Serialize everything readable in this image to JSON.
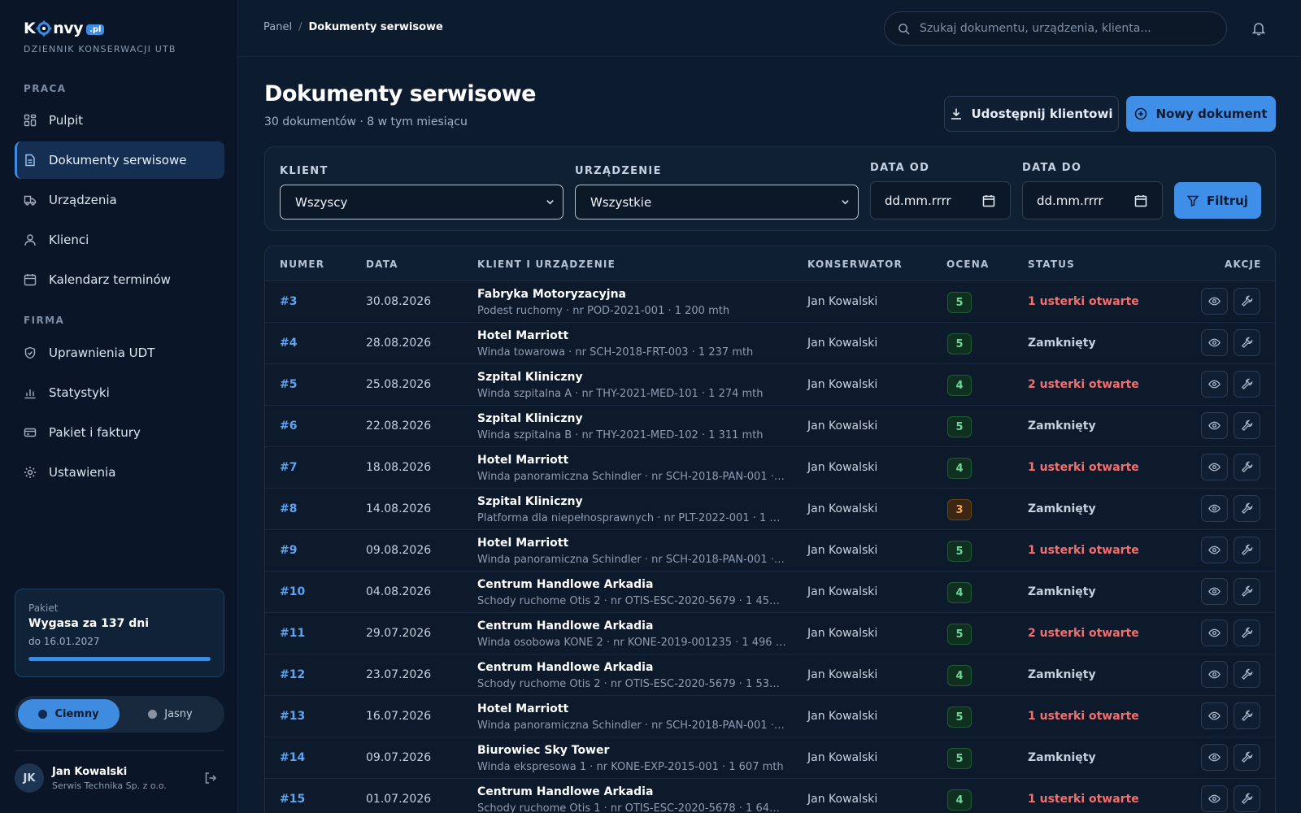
{
  "brand": {
    "logo_left": "K",
    "logo_right": "nvy",
    "logo_badge": ".pl",
    "subtitle": "DZIENNIK KONSERWACJI UTB"
  },
  "sidebar": {
    "section_work": "PRACA",
    "section_company": "FIRMA",
    "items": [
      {
        "label": "Pulpit",
        "icon": "dashboard-icon"
      },
      {
        "label": "Dokumenty serwisowe",
        "icon": "document-icon",
        "active": true
      },
      {
        "label": "Urządzenia",
        "icon": "device-icon"
      },
      {
        "label": "Klienci",
        "icon": "user-icon"
      },
      {
        "label": "Kalendarz terminów",
        "icon": "calendar-icon"
      },
      {
        "label": "Uprawnienia UDT",
        "icon": "shield-icon"
      },
      {
        "label": "Statystyki",
        "icon": "chart-icon"
      },
      {
        "label": "Pakiet i faktury",
        "icon": "card-icon"
      },
      {
        "label": "Ustawienia",
        "icon": "gear-icon"
      }
    ],
    "package": {
      "label": "Pakiet",
      "title": "Wygasa za 137 dni",
      "date": "do 16.01.2027",
      "progress": 1.0
    },
    "theme": {
      "dark": "Ciemny",
      "light": "Jasny",
      "selected": "dark"
    },
    "user": {
      "initials": "JK",
      "name": "Jan Kowalski",
      "company": "Serwis Technika Sp. z o.o."
    }
  },
  "topbar": {
    "breadcrumb_root": "Panel",
    "breadcrumb_sep": "/",
    "breadcrumb_current": "Dokumenty serwisowe",
    "search_placeholder": "Szukaj dokumentu, urządzenia, klienta..."
  },
  "header": {
    "title": "Dokumenty serwisowe",
    "subtitle": "30 dokumentów · 8 w tym miesiącu",
    "share_label": "Udostępnij klientowi",
    "new_label": "Nowy dokument"
  },
  "filters": {
    "client_label": "KLIENT",
    "client_value": "Wszyscy",
    "device_label": "URZĄDZENIE",
    "device_value": "Wszystkie",
    "date_from_label": "DATA OD",
    "date_from_value": "dd.mm.rrrr",
    "date_to_label": "DATA DO",
    "date_to_value": "dd.mm.rrrr",
    "filter_label": "Filtruj"
  },
  "table": {
    "columns": [
      "NUMER",
      "DATA",
      "KLIENT I URZĄDZENIE",
      "KONSERWATOR",
      "OCENA",
      "STATUS",
      "AKCJE"
    ],
    "rows": [
      {
        "num": "#3",
        "date": "30.08.2026",
        "client": "Fabryka Motoryzacyjna",
        "device": "Podest ruchomy · nr POD-2021-001 · 1 200 mth",
        "tech": "Jan Kowalski",
        "score": "5",
        "status": "1 usterki otwarte",
        "open": true
      },
      {
        "num": "#4",
        "date": "28.08.2026",
        "client": "Hotel Marriott",
        "device": "Winda towarowa · nr SCH-2018-FRT-003 · 1 237 mth",
        "tech": "Jan Kowalski",
        "score": "5",
        "status": "Zamknięty",
        "open": false
      },
      {
        "num": "#5",
        "date": "25.08.2026",
        "client": "Szpital Kliniczny",
        "device": "Winda szpitalna A · nr THY-2021-MED-101 · 1 274 mth",
        "tech": "Jan Kowalski",
        "score": "4",
        "status": "2 usterki otwarte",
        "open": true
      },
      {
        "num": "#6",
        "date": "22.08.2026",
        "client": "Szpital Kliniczny",
        "device": "Winda szpitalna B · nr THY-2021-MED-102 · 1 311 mth",
        "tech": "Jan Kowalski",
        "score": "5",
        "status": "Zamknięty",
        "open": false
      },
      {
        "num": "#7",
        "date": "18.08.2026",
        "client": "Hotel Marriott",
        "device": "Winda panoramiczna Schindler · nr SCH-2018-PAN-001 · 1 ...",
        "tech": "Jan Kowalski",
        "score": "4",
        "status": "1 usterki otwarte",
        "open": true
      },
      {
        "num": "#8",
        "date": "14.08.2026",
        "client": "Szpital Kliniczny",
        "device": "Platforma dla niepełnosprawnych · nr PLT-2022-001 · 1 385 ...",
        "tech": "Jan Kowalski",
        "score": "3",
        "status": "Zamknięty",
        "open": false
      },
      {
        "num": "#9",
        "date": "09.08.2026",
        "client": "Hotel Marriott",
        "device": "Winda panoramiczna Schindler · nr SCH-2018-PAN-001 · 1 ...",
        "tech": "Jan Kowalski",
        "score": "5",
        "status": "1 usterki otwarte",
        "open": true
      },
      {
        "num": "#10",
        "date": "04.08.2026",
        "client": "Centrum Handlowe Arkadia",
        "device": "Schody ruchome Otis 2 · nr OTIS-ESC-2020-5679 · 1 459 m...",
        "tech": "Jan Kowalski",
        "score": "4",
        "status": "Zamknięty",
        "open": false
      },
      {
        "num": "#11",
        "date": "29.07.2026",
        "client": "Centrum Handlowe Arkadia",
        "device": "Winda osobowa KONE 2 · nr KONE-2019-001235 · 1 496 mth",
        "tech": "Jan Kowalski",
        "score": "5",
        "status": "2 usterki otwarte",
        "open": true
      },
      {
        "num": "#12",
        "date": "23.07.2026",
        "client": "Centrum Handlowe Arkadia",
        "device": "Schody ruchome Otis 2 · nr OTIS-ESC-2020-5679 · 1 533 m...",
        "tech": "Jan Kowalski",
        "score": "4",
        "status": "Zamknięty",
        "open": false
      },
      {
        "num": "#13",
        "date": "16.07.2026",
        "client": "Hotel Marriott",
        "device": "Winda panoramiczna Schindler · nr SCH-2018-PAN-001 · 1 ...",
        "tech": "Jan Kowalski",
        "score": "5",
        "status": "1 usterki otwarte",
        "open": true
      },
      {
        "num": "#14",
        "date": "09.07.2026",
        "client": "Biurowiec Sky Tower",
        "device": "Winda ekspresowa 1 · nr KONE-EXP-2015-001 · 1 607 mth",
        "tech": "Jan Kowalski",
        "score": "5",
        "status": "Zamknięty",
        "open": false
      },
      {
        "num": "#15",
        "date": "01.07.2026",
        "client": "Centrum Handlowe Arkadia",
        "device": "Schody ruchome Otis 1 · nr OTIS-ESC-2020-5678 · 1 644 m...",
        "tech": "Jan Kowalski",
        "score": "4",
        "status": "1 usterki otwarte",
        "open": true
      }
    ]
  },
  "colors": {
    "accent": "#3f8fe8",
    "open_status": "#f2706f",
    "score_good": "#6ed89a",
    "score_mid": "#f2a75a"
  }
}
